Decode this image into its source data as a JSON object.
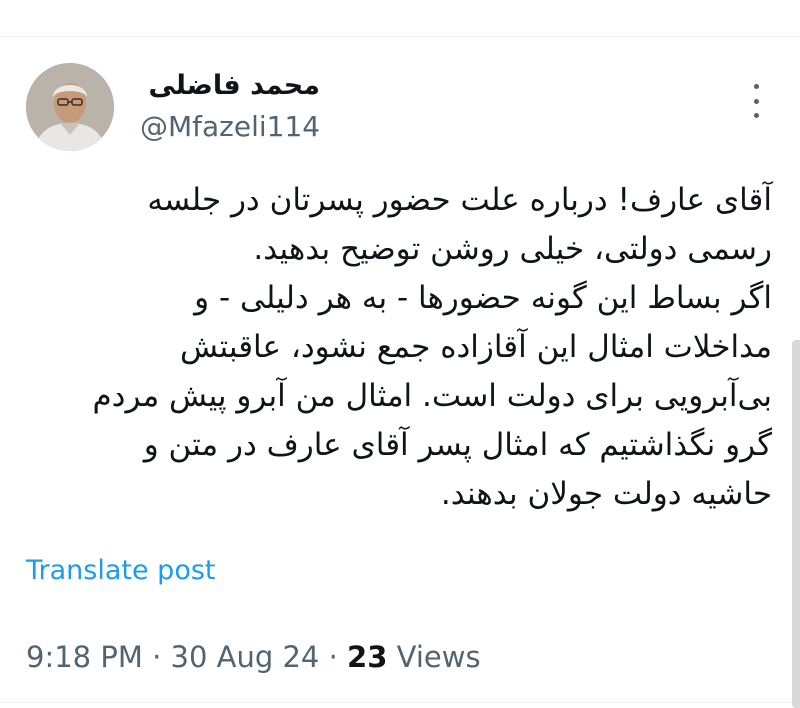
{
  "tweet": {
    "author": {
      "display_name": "محمد فاضلی",
      "handle": "@Mfazeli114"
    },
    "text_lines": [
      "آقای عارف! درباره علت حضور پسرتان در  جلسه",
      "رسمی دولتی، خیلی روشن توضیح بدهید.",
      "اگر بساط این گونه حضورها - به هر دلیلی - و",
      "مداخلات امثال این آقازاده جمع نشود، عاقبتش",
      "بی‌آبرویی برای دولت است. امثال من آبرو پیش مردم",
      "گرو نگذاشتیم که امثال پسر آقای عارف در متن و",
      "حاشیه دولت جولان بدهند."
    ],
    "translate_label": "Translate post",
    "time": "9:18 PM",
    "date": "30 Aug 24",
    "separator": "·",
    "views_count": "23",
    "views_label": "Views"
  },
  "icons": {
    "more": "more-vertical-icon"
  },
  "colors": {
    "link": "#1d9bf0",
    "secondary_text": "#536471",
    "primary_text": "#0f1419"
  }
}
